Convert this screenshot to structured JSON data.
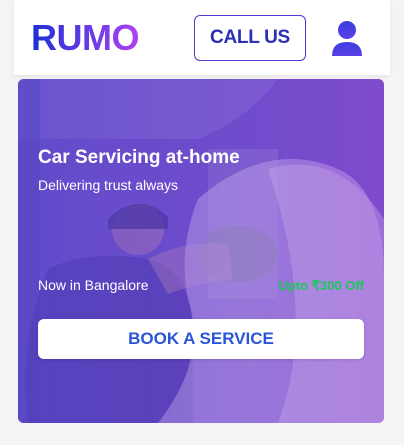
{
  "header": {
    "logo": "RUMO",
    "call_label": "CALL US",
    "user_icon": "user-icon"
  },
  "hero": {
    "title": "Car Servicing at-home",
    "subtitle": "Delivering trust always",
    "location": "Now in Bangalore",
    "offer": "Upto ₹300 Off",
    "cta_label": "BOOK A SERVICE"
  },
  "colors": {
    "brand_start": "#1e2fd6",
    "brand_end": "#b040f0",
    "cta_text": "#2a55d6",
    "offer": "#19c85a",
    "hero_overlay": "#6a47c9"
  }
}
